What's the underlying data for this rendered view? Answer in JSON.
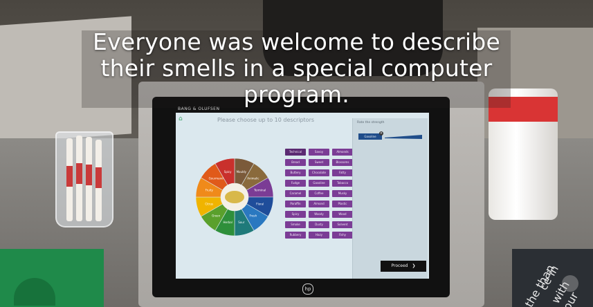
{
  "caption": {
    "line1": "Everyone was welcome to describe",
    "line2": "their smells in a special computer",
    "line3": "program."
  },
  "kiosk": {
    "brand": "BANG & OLUFSEN",
    "hardware_logo": "hp"
  },
  "screen": {
    "title": "Please choose up to 10 descriptors",
    "home_icon": "home-icon",
    "wheel_segments": [
      {
        "label": "Mouldy",
        "color": "#7b5a3a"
      },
      {
        "label": "Animalic",
        "color": "#8a6a3c"
      },
      {
        "label": "Terminal",
        "color": "#7b3c95"
      },
      {
        "label": "Floral",
        "color": "#1f4d9a"
      },
      {
        "label": "Fresh",
        "color": "#2a78c0"
      },
      {
        "label": "Sour",
        "color": "#1f7a7a"
      },
      {
        "label": "Herbal",
        "color": "#2e8f3a"
      },
      {
        "label": "Green",
        "color": "#5aa02c"
      },
      {
        "label": "Citrus",
        "color": "#f0b400"
      },
      {
        "label": "Fruity",
        "color": "#f08a1a"
      },
      {
        "label": "Gourmand",
        "color": "#e05a1a"
      },
      {
        "label": "Spicy",
        "color": "#c9302c"
      }
    ],
    "descriptors": [
      [
        "Technical",
        "Savoy",
        "Almonds"
      ],
      [
        "Bread",
        "Sweet",
        "Blossoms"
      ],
      [
        "Buttery",
        "Chocolate",
        "Fatty"
      ],
      [
        "Fudge",
        "Gasoline",
        "Tobacco"
      ],
      [
        "Caramel",
        "Coffee",
        "Musky"
      ],
      [
        "Paraffin",
        "Almond",
        "Plastic"
      ],
      [
        "Spicy",
        "Woody",
        "Wood"
      ],
      [
        "Smoke",
        "Dusty",
        "Solvent"
      ],
      [
        "Rubbery",
        "Hazy",
        "Fishy"
      ]
    ],
    "strength_panel": {
      "title": "Rate the strength",
      "chip": "Gasoline"
    },
    "proceed_button": "Proceed"
  },
  "scene_text": {
    "right_lines": [
      "the than",
      "ce in",
      "with our"
    ]
  },
  "colors": {
    "screen_bg": "#dbe8ee",
    "chip": "#7b3c95",
    "accent_blue": "#1f4d8a",
    "cylinder_band": "#d93434"
  }
}
